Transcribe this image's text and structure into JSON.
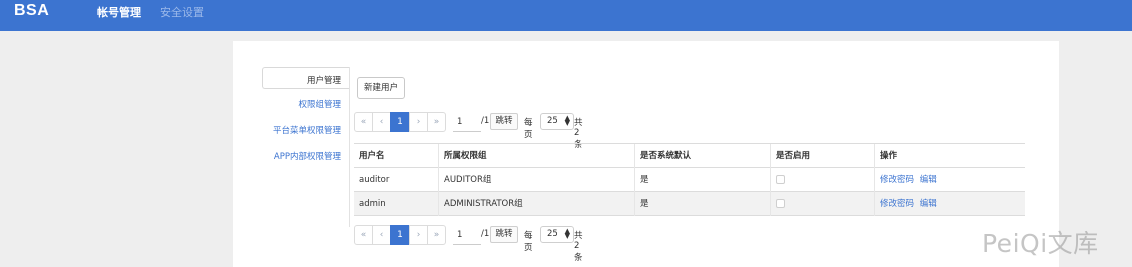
{
  "header": {
    "logo": "BSA",
    "nav": [
      "帐号管理",
      "安全设置"
    ]
  },
  "sidebar": {
    "items": [
      "用户管理",
      "权限组管理",
      "平台菜单权限管理",
      "APP内部权限管理"
    ]
  },
  "toolbar": {
    "new_user_label": "新建用户"
  },
  "pagination": {
    "first": "«",
    "prev": "‹",
    "current": "1",
    "next": "›",
    "last": "»",
    "page_input": "1",
    "total_pages": "/1",
    "jump_label": "跳转",
    "per_page_label": "每页",
    "per_page_value": "25",
    "total_count": "共2条"
  },
  "table": {
    "headers": [
      "用户名",
      "所属权限组",
      "是否系统默认",
      "是否启用",
      "操作"
    ],
    "rows": [
      {
        "username": "auditor",
        "group": "AUDITOR组",
        "is_default": "是",
        "enabled": false,
        "actions": [
          "修改密码",
          "编辑"
        ]
      },
      {
        "username": "admin",
        "group": "ADMINISTRATOR组",
        "is_default": "是",
        "enabled": false,
        "actions": [
          "修改密码",
          "编辑"
        ]
      }
    ]
  },
  "watermark": "PeiQi文库",
  "colors": {
    "brand": "#3c74d0",
    "background": "#eeeeee"
  }
}
